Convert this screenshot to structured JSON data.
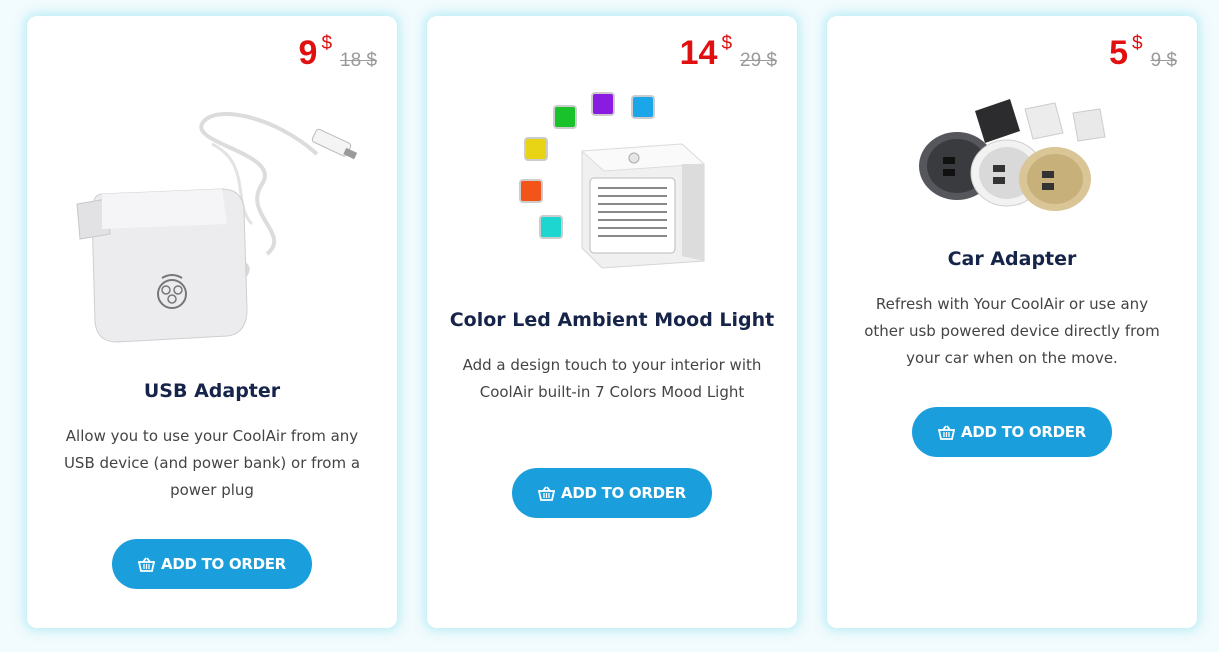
{
  "products": [
    {
      "price": "9",
      "currency": "$",
      "old_price": "18 $",
      "title": "USB Adapter",
      "description": "Allow you to use your CoolAir from any USB device (and power bank) or from a power plug",
      "button": "ADD TO ORDER",
      "image": "usb-wall-adapter"
    },
    {
      "price": "14",
      "currency": "$",
      "old_price": "29 $",
      "title": "Color Led Ambient Mood Light",
      "description": "Add a design touch to your interior with CoolAir built-in 7 Colors Mood Light",
      "button": "ADD TO ORDER",
      "image": "coolair-mood-light",
      "led_colors": [
        "#19c22a",
        "#8a1be0",
        "#1aa6e8",
        "#e8d414",
        "#f2541a",
        "#1ed6d0"
      ]
    },
    {
      "price": "5",
      "currency": "$",
      "old_price": "9 $",
      "title": "Car Adapter",
      "description": "Refresh with Your CoolAir or use any other usb powered device directly from your car when on the move.",
      "button": "ADD TO ORDER",
      "image": "car-usb-adapters"
    }
  ],
  "colors": {
    "price": "#e01010",
    "button": "#1b9fdc",
    "title": "#17244a",
    "card_glow": "#8ce1f0"
  },
  "icons": {
    "button_icon": "basket-icon"
  }
}
